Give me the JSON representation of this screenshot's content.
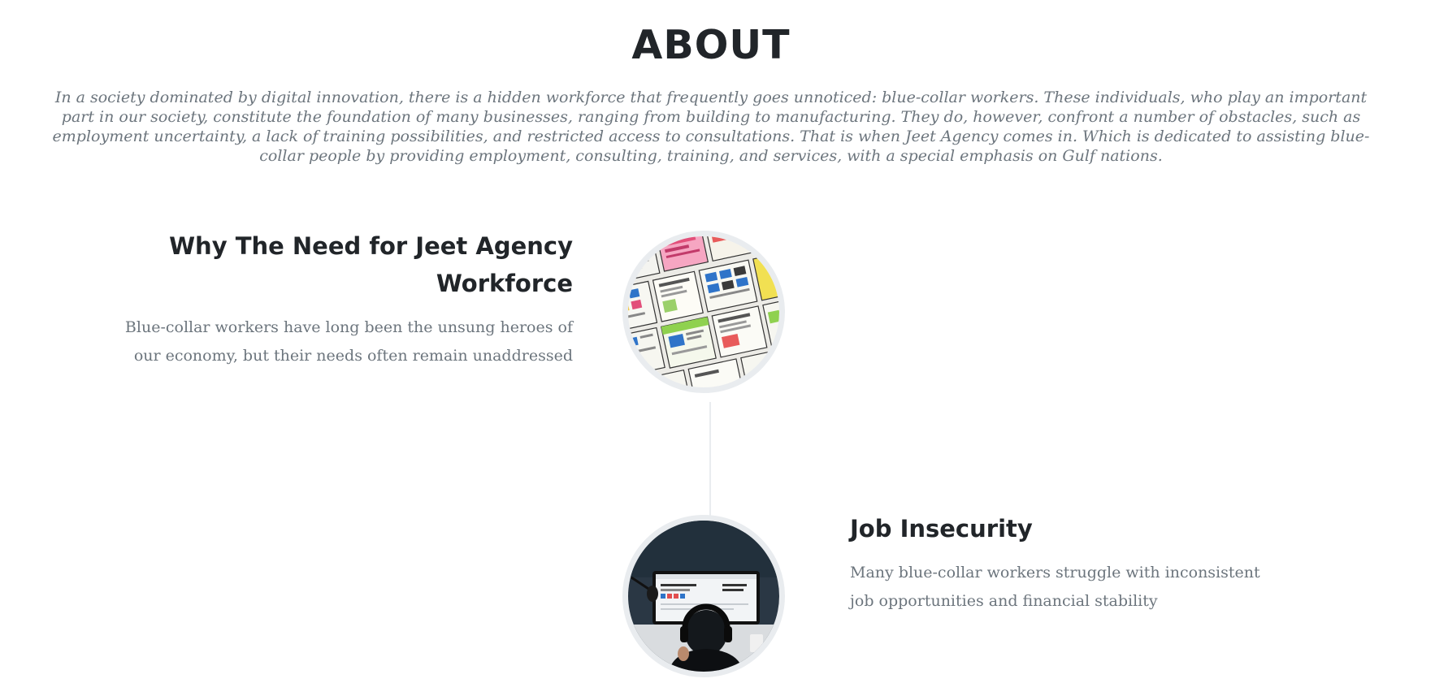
{
  "about": {
    "title": "ABOUT",
    "intro": "In a society dominated by digital innovation, there is a hidden workforce that frequently goes unnoticed: blue-collar workers. These individuals, who play an important part in our society, constitute the foundation of many businesses, ranging from building to manufacturing. They do, however, confront a number of obstacles, such as employment uncertainty, a lack of training possibilities, and restricted access to consultations. That is when Jeet Agency comes in. Which is dedicated to assisting blue-collar people by providing employment, consulting, training, and services, with a special emphasis on Gulf nations."
  },
  "timeline": {
    "items": [
      {
        "heading": "Why The Need for Jeet Agency Workforce",
        "text": "Blue-collar workers have long been the unsung heroes of our economy, but their needs often remain unaddressed",
        "image": "wireframe-sketches-photo"
      },
      {
        "heading": "Job Insecurity",
        "text": "Many blue-collar workers struggle with inconsistent job opportunities and financial stability",
        "image": "person-at-monitor-photo"
      }
    ]
  },
  "colors": {
    "heading": "#212529",
    "muted_text": "#6c757d",
    "timeline_border": "#e9ecef"
  }
}
